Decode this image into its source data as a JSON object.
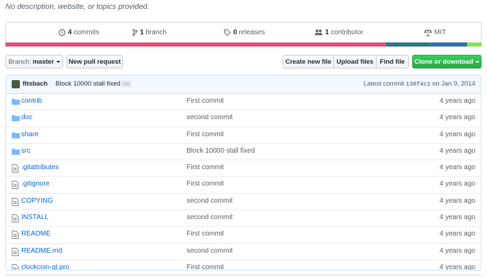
{
  "description": "No description, website, or topics provided.",
  "summary": {
    "commits_count": "4",
    "commits_label": "commits",
    "branch_count": "1",
    "branch_label": "branch",
    "releases_count": "0",
    "releases_label": "releases",
    "contributor_count": "1",
    "contributor_label": "contributor",
    "license": "MIT"
  },
  "language_bar": [
    {
      "color": "#e34c77",
      "fraction": 0.8
    },
    {
      "color": "#2b7489",
      "fraction": 0.09
    },
    {
      "color": "#3572a5",
      "fraction": 0.08
    },
    {
      "color": "#89e051",
      "fraction": 0.03
    }
  ],
  "toolbar": {
    "branch_prefix": "Branch:",
    "branch_name": "master",
    "new_pr": "New pull request",
    "create_file": "Create new file",
    "upload_files": "Upload files",
    "find_file": "Find file",
    "clone": "Clone or download"
  },
  "latest_commit": {
    "author": "fitsbach",
    "message": "Block 10000 stall fixed",
    "ellipsis": "…",
    "prefix": "Latest commit",
    "sha": "138f4c1",
    "date": "on Jan 9, 2014"
  },
  "files": [
    {
      "type": "dir",
      "name": "contrib",
      "message": "First commit",
      "age": "4 years ago"
    },
    {
      "type": "dir",
      "name": "doc",
      "message": "second commit",
      "age": "4 years ago"
    },
    {
      "type": "dir",
      "name": "share",
      "message": "First commit",
      "age": "4 years ago"
    },
    {
      "type": "dir",
      "name": "src",
      "message": "Block 10000 stall fixed",
      "age": "4 years ago"
    },
    {
      "type": "file",
      "name": ".gitattributes",
      "message": "First commit",
      "age": "4 years ago"
    },
    {
      "type": "file",
      "name": ".gitignore",
      "message": "First commit",
      "age": "4 years ago"
    },
    {
      "type": "file",
      "name": "COPYING",
      "message": "second commit",
      "age": "4 years ago"
    },
    {
      "type": "file",
      "name": "INSTALL",
      "message": "second commit",
      "age": "4 years ago"
    },
    {
      "type": "file",
      "name": "README",
      "message": "First commit",
      "age": "4 years ago"
    },
    {
      "type": "file",
      "name": "README.md",
      "message": "second commit",
      "age": "4 years ago"
    },
    {
      "type": "file",
      "name": "clockcoin-qt.pro",
      "message": "First commit",
      "age": "4 years ago"
    }
  ]
}
